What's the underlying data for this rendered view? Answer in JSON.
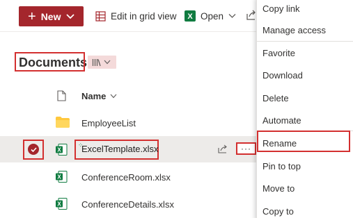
{
  "command_bar": {
    "new_label": "New",
    "edit_grid_label": "Edit in grid view",
    "open_label": "Open"
  },
  "library": {
    "title": "Documents",
    "column_name": "Name",
    "rows": [
      {
        "name": "EmployeeList",
        "type": "folder"
      },
      {
        "name": "ExcelTemplate.xlsx",
        "type": "excel",
        "selected": true
      },
      {
        "name": "ConferenceRoom.xlsx",
        "type": "excel"
      },
      {
        "name": "ConferenceDetails.xlsx",
        "type": "excel"
      }
    ],
    "more_label": "···"
  },
  "context_menu": {
    "items": [
      "Copy link",
      "Manage access",
      "Favorite",
      "Download",
      "Delete",
      "Automate",
      "Rename",
      "Pin to top",
      "Move to",
      "Copy to"
    ]
  },
  "colors": {
    "accent": "#a4262c",
    "highlight": "#d32f2f",
    "excel_green": "#107c41",
    "folder_yellow": "#ffc83d",
    "selected_row": "#edebe9"
  },
  "icons": {
    "grid": "grid-icon",
    "excel": "excel-icon",
    "folder": "folder-icon",
    "library": "library-icon",
    "share": "share-icon",
    "check": "check-icon"
  }
}
